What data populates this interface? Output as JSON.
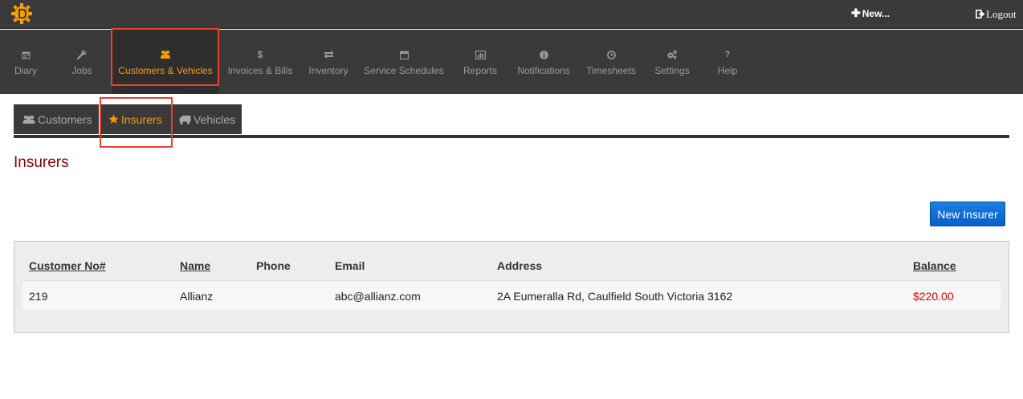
{
  "topbar": {
    "new_label": "New...",
    "logout_label": "Logout"
  },
  "mainnav": {
    "items": [
      {
        "label": "Diary",
        "icon": "calendar-icon"
      },
      {
        "label": "Jobs",
        "icon": "wrench-icon"
      },
      {
        "label": "Customers & Vehicles",
        "icon": "users-icon"
      },
      {
        "label": "Invoices & Bills",
        "icon": "dollar-icon"
      },
      {
        "label": "Inventory",
        "icon": "exchange-icon"
      },
      {
        "label": "Service Schedules",
        "icon": "calendar-icon"
      },
      {
        "label": "Reports",
        "icon": "bar-chart-icon"
      },
      {
        "label": "Notifications",
        "icon": "info-icon"
      },
      {
        "label": "Timesheets",
        "icon": "clock-icon"
      },
      {
        "label": "Settings",
        "icon": "gears-icon"
      },
      {
        "label": "Help",
        "icon": "question-icon"
      }
    ],
    "active": "Customers & Vehicles"
  },
  "subtabs": {
    "items": [
      {
        "label": "Customers",
        "icon": "users-icon"
      },
      {
        "label": "Insurers",
        "icon": "star-icon"
      },
      {
        "label": "Vehicles",
        "icon": "truck-icon"
      }
    ],
    "active": "Insurers"
  },
  "page": {
    "title": "Insurers",
    "new_button": "New Insurer"
  },
  "table": {
    "headers": [
      "Customer No#",
      "Name",
      "Phone",
      "Email",
      "Address",
      "Balance"
    ],
    "rows": [
      {
        "customer_no": "219",
        "name": "Allianz",
        "phone": "",
        "email": "abc@allianz.com",
        "address": "2A Eumeralla Rd, Caulfield South Victoria 3162",
        "balance": "$220.00"
      }
    ]
  },
  "colors": {
    "accent": "#ff9900",
    "title": "#8b0000",
    "balance": "#e00000",
    "button": "#0a5fc8",
    "highlight_box": "#e8402a",
    "nav_bg": "#3a3a3a"
  }
}
